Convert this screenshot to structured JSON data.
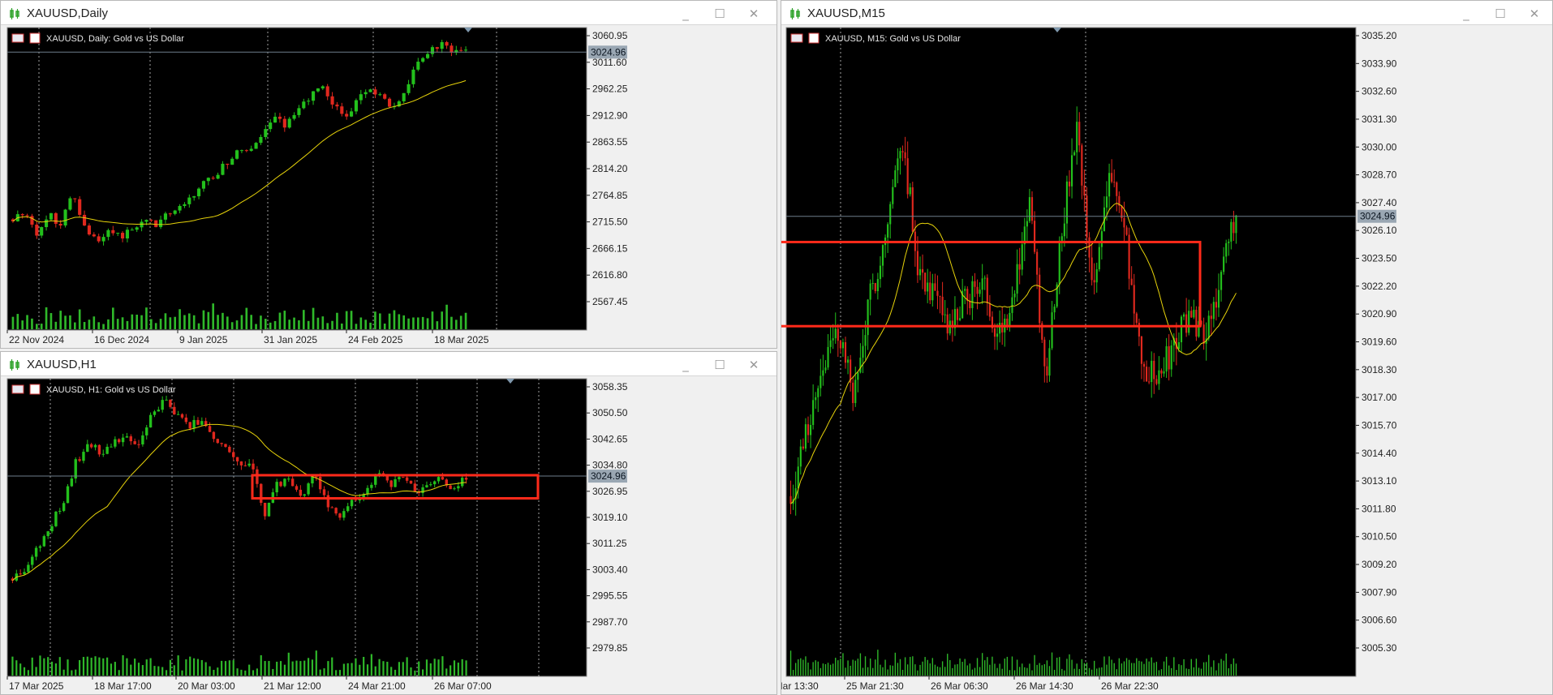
{
  "colors": {
    "background": "#000000",
    "axis_text": "#e6e6e6",
    "bull": "#23c01c",
    "bear": "#e0281e",
    "ma_line": "#e6d20a",
    "volume": "#2fb82a",
    "grid": "#d8d8d8",
    "price_line": "#6e7e8c",
    "highlight_box": "#ff2a1a",
    "price_tag_bg": "#9aa7b3",
    "price_tag_text": "#0b1520"
  },
  "window_controls": {
    "minimize": "_",
    "maximize": "☐",
    "close": "✕"
  },
  "windows": [
    {
      "id": "daily",
      "title": "XAUUSD,Daily",
      "chart_header": "XAUUSD, Daily:  Gold vs US Dollar",
      "icon_name": "candlestick-chart-icon",
      "price_tag": "3024.96",
      "price_ticks": [
        "3060.95",
        "3011.60",
        "2962.25",
        "2912.90",
        "2863.55",
        "2814.20",
        "2764.85",
        "2715.50",
        "2666.15",
        "2616.80",
        "2567.45"
      ],
      "time_ticks": [
        "22 Nov 2024",
        "16 Dec 2024",
        "9 Jan 2025",
        "31 Jan 2025",
        "24 Feb 2025",
        "18 Mar 2025"
      ]
    },
    {
      "id": "h1",
      "title": "XAUUSD,H1",
      "chart_header": "XAUUSD, H1:  Gold vs US Dollar",
      "icon_name": "candlestick-chart-icon",
      "price_tag": "3024.96",
      "price_ticks": [
        "3058.35",
        "3050.50",
        "3042.65",
        "3034.80",
        "3026.95",
        "3019.10",
        "3011.25",
        "3003.40",
        "2995.55",
        "2987.70",
        "2979.85"
      ],
      "time_ticks": [
        "17 Mar 2025",
        "18 Mar 17:00",
        "20 Mar 03:00",
        "21 Mar 12:00",
        "24 Mar 21:00",
        "26 Mar 07:00"
      ]
    },
    {
      "id": "m15",
      "title": "XAUUSD,M15",
      "chart_header": "XAUUSD, M15:  Gold vs US Dollar",
      "icon_name": "candlestick-chart-icon",
      "price_tag": "3024.96",
      "price_ticks": [
        "3035.20",
        "3033.90",
        "3032.60",
        "3031.30",
        "3030.00",
        "3028.70",
        "3027.40",
        "3026.10",
        "3023.50",
        "3022.20",
        "3020.90",
        "3019.60",
        "3018.30",
        "3017.00",
        "3015.70",
        "3014.40",
        "3013.10",
        "3011.80",
        "3010.50",
        "3009.20",
        "3007.90",
        "3006.60",
        "3005.30"
      ],
      "time_ticks": [
        "25 Mar 2025",
        "25 Mar 13:30",
        "25 Mar 21:30",
        "26 Mar 06:30",
        "26 Mar 14:30",
        "26 Mar 22:30"
      ]
    }
  ],
  "chart_data": [
    {
      "type": "candlestick",
      "title": "XAUUSD, Daily:  Gold vs US Dollar",
      "ylim": [
        2540,
        3080
      ],
      "current_price": 3024.96,
      "x_tick_labels": [
        "22 Nov 2024",
        "16 Dec 2024",
        "9 Jan 2025",
        "31 Jan 2025",
        "24 Feb 2025",
        "18 Mar 2025"
      ],
      "close_path": [
        2650,
        2670,
        2620,
        2660,
        2640,
        2710,
        2640,
        2600,
        2630,
        2610,
        2625,
        2650,
        2640,
        2660,
        2680,
        2700,
        2730,
        2750,
        2780,
        2810,
        2800,
        2840,
        2880,
        2860,
        2900,
        2930,
        2940,
        2900,
        2880,
        2920,
        2940,
        2920,
        2900,
        2950,
        3000,
        3030,
        3040,
        3030,
        3025
      ],
      "series": [
        {
          "name": "moving average",
          "values_approx": [
            2650,
            2640,
            2650,
            2630,
            2640,
            2640,
            2650,
            2700,
            2760,
            2820,
            2880,
            2900,
            2920,
            2960,
            2970
          ]
        }
      ]
    },
    {
      "type": "candlestick",
      "title": "XAUUSD, H1:  Gold vs US Dollar",
      "ylim": [
        2975,
        3062
      ],
      "current_price": 3024.96,
      "x_tick_labels": [
        "17 Mar 2025",
        "18 Mar 17:00",
        "20 Mar 03:00",
        "21 Mar 12:00",
        "24 Mar 21:00",
        "26 Mar 07:00"
      ],
      "close_path": [
        2986,
        2990,
        2998,
        3006,
        3015,
        3030,
        3037,
        3034,
        3038,
        3040,
        3036,
        3048,
        3054,
        3048,
        3044,
        3046,
        3040,
        3036,
        3030,
        3028,
        3010,
        3022,
        3024,
        3018,
        3026,
        3014,
        3010,
        3016,
        3019,
        3026,
        3022,
        3024,
        3019,
        3022,
        3024,
        3020,
        3025
      ],
      "highlight_range": [
        3016.5,
        3025.3
      ]
    },
    {
      "type": "candlestick",
      "title": "XAUUSD, M15:  Gold vs US Dollar",
      "ylim": [
        3004.3,
        3036.4
      ],
      "current_price": 3024.96,
      "x_tick_labels": [
        "25 Mar 2025",
        "25 Mar 13:30",
        "25 Mar 21:30",
        "26 Mar 06:30",
        "26 Mar 14:30",
        "26 Mar 22:30"
      ],
      "close_path": [
        3008,
        3012,
        3016,
        3018,
        3014,
        3020,
        3024,
        3030,
        3022,
        3020,
        3018,
        3020,
        3021,
        3018,
        3020,
        3026,
        3015,
        3024,
        3030,
        3020,
        3028,
        3024,
        3016,
        3015,
        3017,
        3019,
        3018,
        3021,
        3025
      ],
      "highlight_range": [
        3018.3,
        3023.4
      ]
    }
  ]
}
